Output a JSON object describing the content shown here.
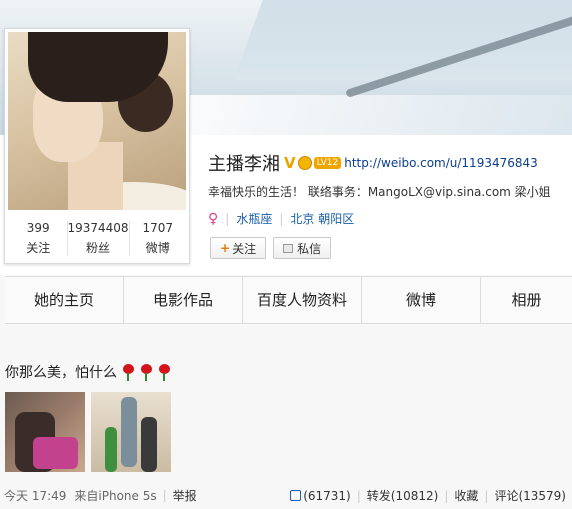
{
  "profile": {
    "name": "主播李湘",
    "verified_badge": "V",
    "level_badge": "LV12",
    "url": "http://weibo.com/u/1193476843",
    "bio": "幸福快乐的生活！ 联络事务：MangoLX@vip.sina.com 梁小姐",
    "gender_icon": "female-icon",
    "constellation": "水瓶座",
    "location": "北京 朝阳区",
    "follow_label": "关注",
    "message_label": "私信"
  },
  "stats": [
    {
      "value": "399",
      "label": "关注"
    },
    {
      "value": "19374408",
      "label": "粉丝"
    },
    {
      "value": "1707",
      "label": "微博"
    }
  ],
  "tabs": [
    "她的主页",
    "电影作品",
    "百度人物资料",
    "微博",
    "相册"
  ],
  "post": {
    "text": "你那么美，怕什么",
    "time": "今天 17:49",
    "source": "来自iPhone 5s",
    "report": "举报",
    "likes": "(61731)",
    "repost": "转发(10812)",
    "favorite": "收藏",
    "comment": "评论(13579)"
  },
  "colors": {
    "link": "#1a5ea8",
    "accent": "#e8790c"
  }
}
